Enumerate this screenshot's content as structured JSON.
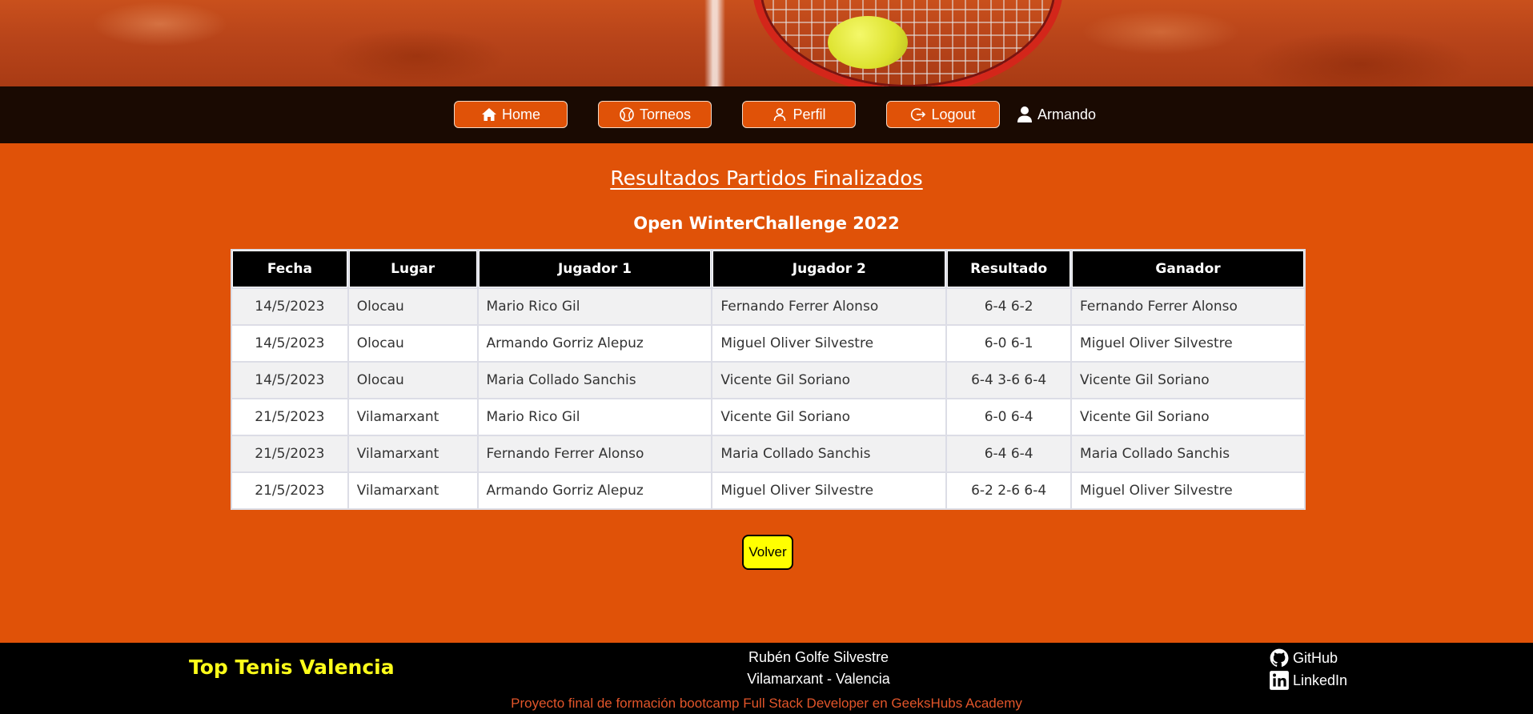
{
  "nav": {
    "items": [
      {
        "label": "Home",
        "icon": "home-icon"
      },
      {
        "label": "Torneos",
        "icon": "tennis-ball-icon"
      },
      {
        "label": "Perfil",
        "icon": "user-icon"
      },
      {
        "label": "Logout",
        "icon": "logout-icon"
      }
    ],
    "user_name": "Armando"
  },
  "main": {
    "title": "Resultados Partidos Finalizados",
    "tournament": "Open WinterChallenge 2022",
    "table": {
      "headers": [
        "Fecha",
        "Lugar",
        "Jugador 1",
        "Jugador 2",
        "Resultado",
        "Ganador"
      ],
      "rows": [
        [
          "14/5/2023",
          "Olocau",
          "Mario Rico Gil",
          "Fernando Ferrer Alonso",
          "6-4 6-2",
          "Fernando Ferrer Alonso"
        ],
        [
          "14/5/2023",
          "Olocau",
          "Armando Gorriz Alepuz",
          "Miguel Oliver Silvestre",
          "6-0 6-1",
          "Miguel Oliver Silvestre"
        ],
        [
          "14/5/2023",
          "Olocau",
          "Maria Collado Sanchis",
          "Vicente Gil Soriano",
          "6-4 3-6 6-4",
          "Vicente Gil Soriano"
        ],
        [
          "21/5/2023",
          "Vilamarxant",
          "Mario Rico Gil",
          "Vicente Gil Soriano",
          "6-0 6-4",
          "Vicente Gil Soriano"
        ],
        [
          "21/5/2023",
          "Vilamarxant",
          "Fernando Ferrer Alonso",
          "Maria Collado Sanchis",
          "6-4 6-4",
          "Maria Collado Sanchis"
        ],
        [
          "21/5/2023",
          "Vilamarxant",
          "Armando Gorriz Alepuz",
          "Miguel Oliver Silvestre",
          "6-2 2-6 6-4",
          "Miguel Oliver Silvestre"
        ]
      ]
    },
    "back_label": "Volver"
  },
  "footer": {
    "brand": "Top Tenis Valencia",
    "author": "Rubén Golfe Silvestre",
    "location": "Vilamarxant - Valencia",
    "credits": "Proyecto final de formación bootcamp Full Stack Developer en GeeksHubs Academy",
    "github_label": "GitHub",
    "linkedin_label": "LinkedIn"
  },
  "colors": {
    "accent": "#e05208",
    "nav_bg": "#1a0a02",
    "volver_bg": "#ffff00",
    "brand": "#ffff1a",
    "credits": "#e2552a"
  }
}
